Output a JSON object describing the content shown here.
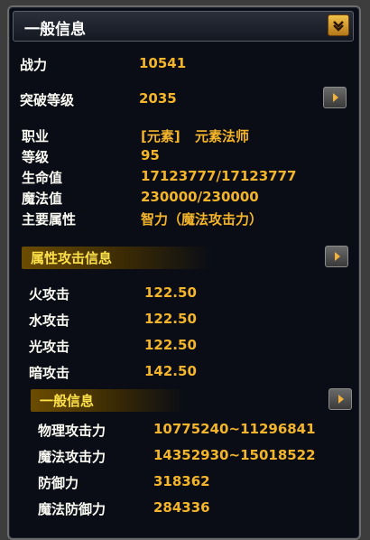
{
  "header": {
    "title": "一般信息"
  },
  "stats": {
    "combat_label": "战力",
    "combat_value": "10541",
    "breakthrough_label": "突破等级",
    "breakthrough_value": "2035"
  },
  "basic": {
    "job_label": "职业",
    "job_tag": "[元素]",
    "job_value": "元素法师",
    "level_label": "等级",
    "level_value": "95",
    "hp_label": "生命值",
    "hp_value": "17123777/17123777",
    "mp_label": "魔法值",
    "mp_value": "230000/230000",
    "main_attr_label": "主要属性",
    "main_attr_value": "智力（魔法攻击力）"
  },
  "elemental": {
    "title": "属性攻击信息",
    "rows": [
      {
        "label": "火攻击",
        "value": "122.50"
      },
      {
        "label": "水攻击",
        "value": "122.50"
      },
      {
        "label": "光攻击",
        "value": "122.50"
      },
      {
        "label": "暗攻击",
        "value": "142.50"
      }
    ]
  },
  "general": {
    "title": "一般信息",
    "rows": [
      {
        "label": "物理攻击力",
        "value": "10775240~11296841"
      },
      {
        "label": "魔法攻击力",
        "value": "14352930~15018522"
      },
      {
        "label": "防御力",
        "value": "318362"
      },
      {
        "label": "魔法防御力",
        "value": "284336"
      }
    ]
  },
  "icons": {
    "dropdown": "chevron-down-icon",
    "expand": "arrow-right-icon"
  },
  "colors": {
    "label": "#fbfbf4",
    "value": "#f4b52a",
    "section": "#fde14a",
    "background": "#0a0d16"
  }
}
